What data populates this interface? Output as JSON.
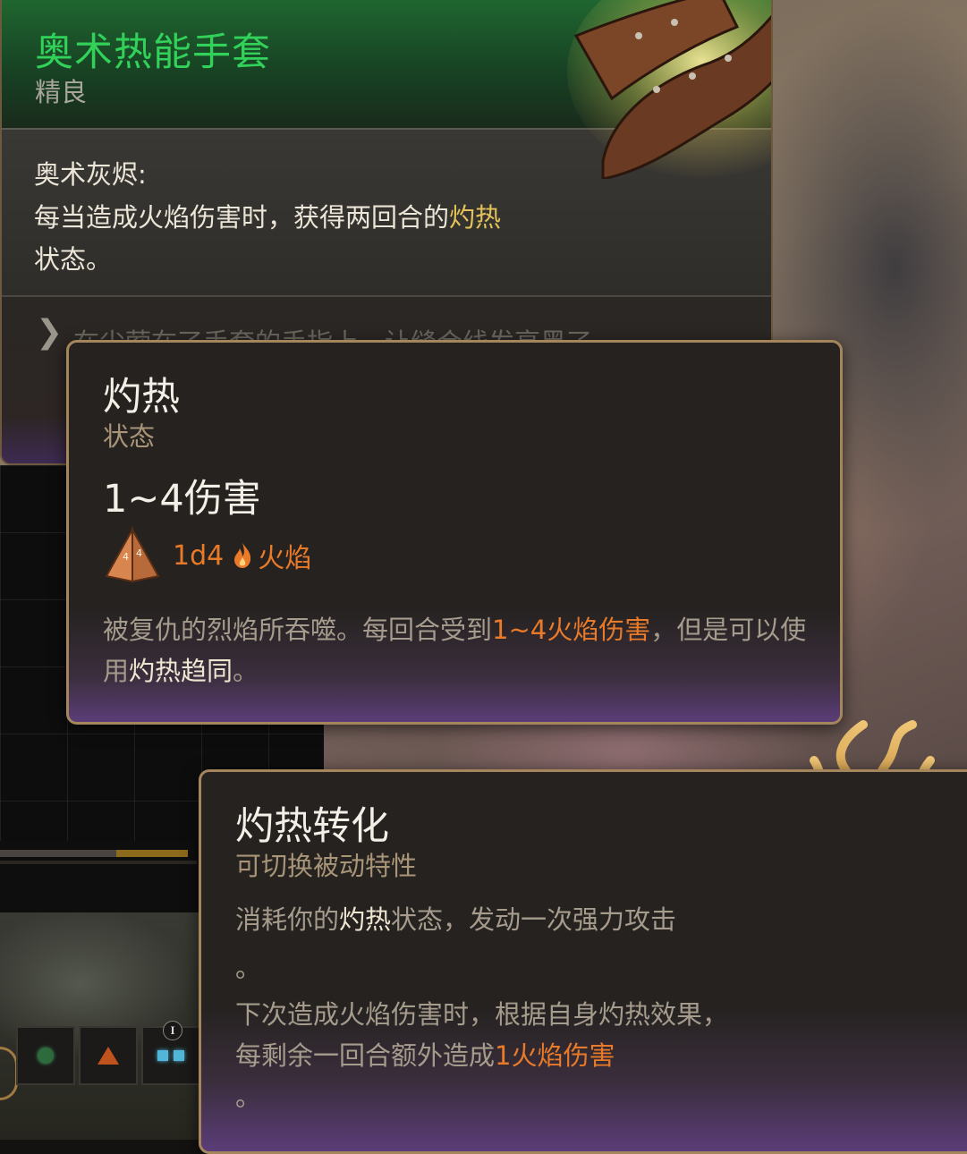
{
  "item_tooltip": {
    "title": "奥术热能手套",
    "rarity": "精良",
    "effect_name": "奥术灰烬:",
    "effect_desc_before": "每当造成火焰伤害时，获得两回合的",
    "effect_desc_highlight": "灼热",
    "effect_desc_after": "状态。",
    "lore_icon": "chevron-right-icon",
    "lore_text": "在尘萦在了手套的手指上，让缝合线发亮黑了",
    "title_color": "#32d25a"
  },
  "status_tooltip": {
    "title": "灼热",
    "type": "状态",
    "damage": "1~4伤害",
    "dice_icon": "d4-dice-icon",
    "dice": "1d4",
    "element_icon": "fire-icon",
    "element": "火焰",
    "desc_before": "被复仇的烈焰所吞噬。每回合受到",
    "desc_damage": "1~4火焰伤害",
    "desc_mid": "，但是可以使用",
    "desc_link": "灼热趋同",
    "desc_after": "。",
    "accent_color": "#e87a2a"
  },
  "passive_tooltip": {
    "title": "灼热转化",
    "type": "可切换被动特性",
    "desc1_before": "消耗你的",
    "desc1_highlight": "灼热",
    "desc1_after": "状态，发动一次强力攻击",
    "desc1_end": "。",
    "desc2_before": "下次造成火焰伤害时，根据自身灼热效果，每剩余一回合额外造成",
    "desc2_damage": "1火焰伤害",
    "desc2_end": "。"
  },
  "hotbar": {
    "badge": "I",
    "slots": [
      "green-orb-icon",
      "orange-triangle-icon",
      "blue-squares-icon"
    ]
  }
}
